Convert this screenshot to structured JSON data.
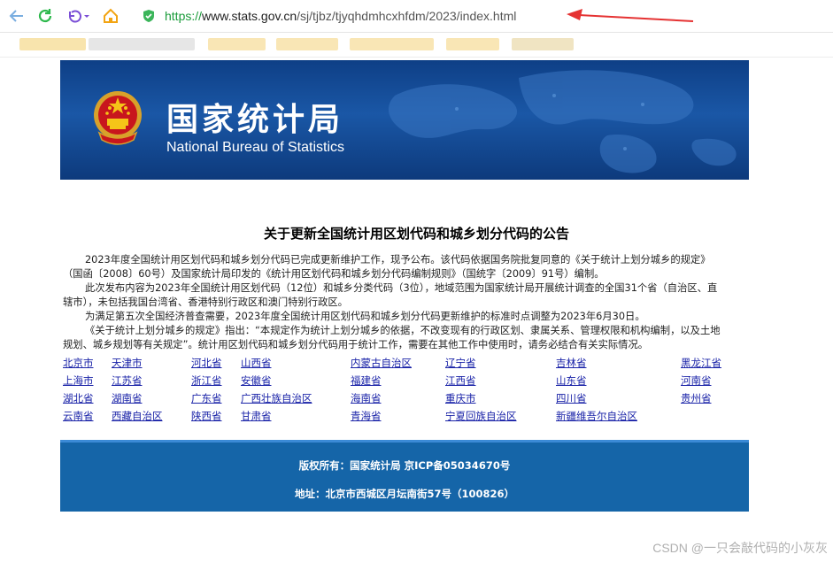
{
  "browser": {
    "url_scheme": "https://",
    "url_host": "www.stats.gov.cn",
    "url_path": "/sj/tjbz/tjyqhdmhcxhfdm/2023/index.html",
    "accent": "#1a9b3a"
  },
  "banner": {
    "title_cn": "国家统计局",
    "title_en": "National Bureau of Statistics",
    "emblem_icon": "national-emblem-icon"
  },
  "notice": {
    "title": "关于更新全国统计用区划代码和城乡划分代码的公告",
    "paragraphs": [
      "2023年度全国统计用区划代码和城乡划分代码已完成更新维护工作，现予公布。该代码依据国务院批复同意的《关于统计上划分城乡的规定》（国函〔2008〕60号）及国家统计局印发的《统计用区划代码和城乡划分代码编制规则》（国统字〔2009〕91号）编制。",
      "此次发布内容为2023年全国统计用区划代码（12位）和城乡分类代码（3位），地域范围为国家统计局开展统计调查的全国31个省（自治区、直辖市），未包括我国台湾省、香港特别行政区和澳门特别行政区。",
      "为满足第五次全国经济普查需要，2023年度全国统计用区划代码和城乡划分代码更新维护的标准时点调整为2023年6月30日。",
      "《关于统计上划分城乡的规定》指出：“本规定作为统计上划分城乡的依据，不改变现有的行政区划、隶属关系、管理权限和机构编制，以及土地规划、城乡规划等有关规定”。统计用区划代码和城乡划分代码用于统计工作，需要在其他工作中使用时，请务必结合有关实际情况。"
    ]
  },
  "regions": [
    [
      "北京市",
      "天津市",
      "河北省",
      "山西省",
      "内蒙古自治区",
      "辽宁省",
      "吉林省",
      "黑龙江省"
    ],
    [
      "上海市",
      "江苏省",
      "浙江省",
      "安徽省",
      "福建省",
      "江西省",
      "山东省",
      "河南省"
    ],
    [
      "湖北省",
      "湖南省",
      "广东省",
      "广西壮族自治区",
      "海南省",
      "重庆市",
      "四川省",
      "贵州省"
    ],
    [
      "云南省",
      "西藏自治区",
      "陕西省",
      "甘肃省",
      "青海省",
      "宁夏回族自治区",
      "新疆维吾尔自治区"
    ]
  ],
  "footer": {
    "copyright": "版权所有：国家统计局 京ICP备05034670号",
    "address": "地址：北京市西城区月坛南街57号（100826）"
  },
  "watermark": "CSDN @一只会敲代码的小灰灰"
}
